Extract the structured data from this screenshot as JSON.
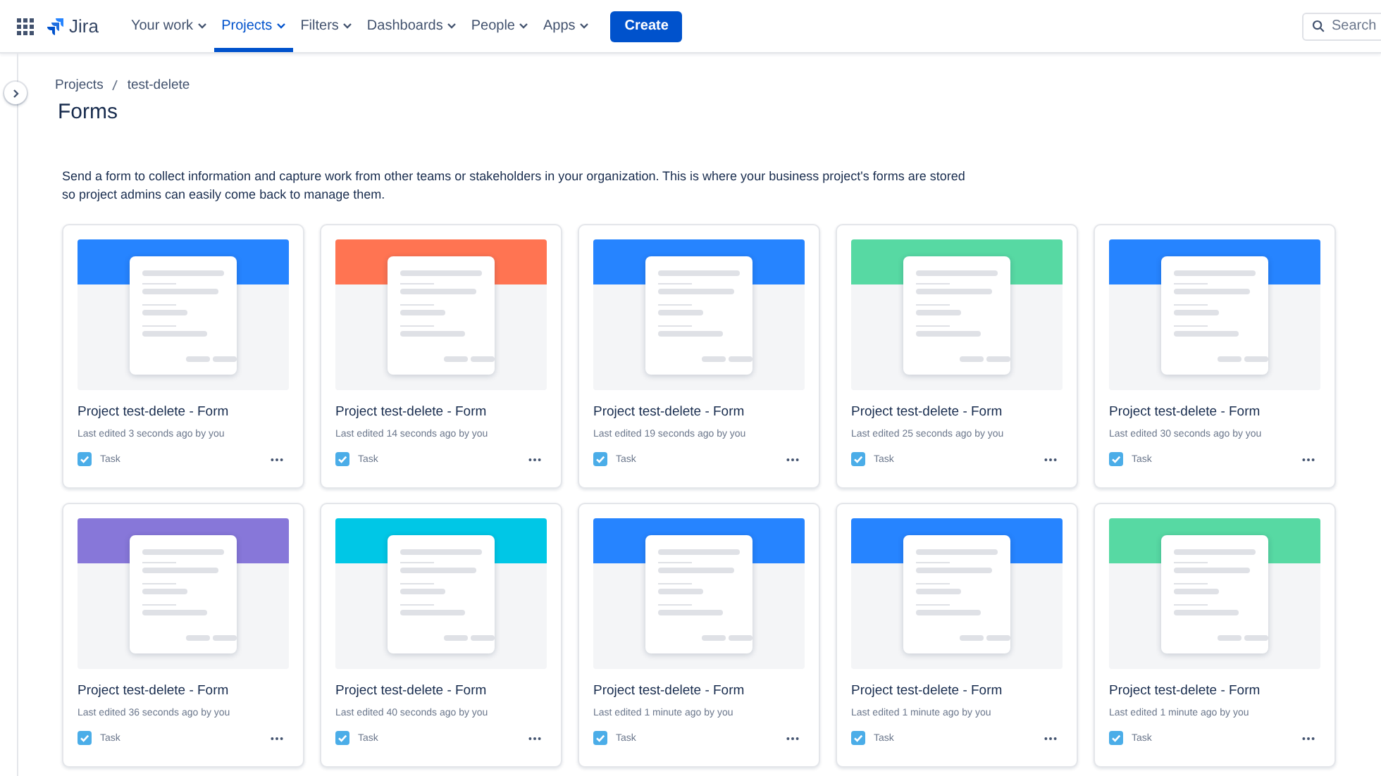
{
  "top_nav": {
    "product": "Jira",
    "menus": [
      {
        "label": "Your work",
        "selected": false
      },
      {
        "label": "Projects",
        "selected": true
      },
      {
        "label": "Filters",
        "selected": false
      },
      {
        "label": "Dashboards",
        "selected": false
      },
      {
        "label": "People",
        "selected": false
      },
      {
        "label": "Apps",
        "selected": false
      }
    ],
    "create_button": "Create",
    "search": {
      "placeholder": "Search"
    }
  },
  "breadcrumbs": [
    "Projects",
    "test-delete"
  ],
  "page_title": "Forms",
  "description": "Send a form to collect information and capture work from other teams or stakeholders in your organization. This is where your business project's forms are stored so project admins can easily come back to manage them.",
  "forms": [
    {
      "title": "Project test-delete - Form",
      "edited": "Last edited 3 seconds ago by you",
      "type": "Task",
      "color": "#2684ff"
    },
    {
      "title": "Project test-delete - Form",
      "edited": "Last edited 14 seconds ago by you",
      "type": "Task",
      "color": "#ff7452"
    },
    {
      "title": "Project test-delete - Form",
      "edited": "Last edited 19 seconds ago by you",
      "type": "Task",
      "color": "#2684ff"
    },
    {
      "title": "Project test-delete - Form",
      "edited": "Last edited 25 seconds ago by you",
      "type": "Task",
      "color": "#57d9a3"
    },
    {
      "title": "Project test-delete - Form",
      "edited": "Last edited 30 seconds ago by you",
      "type": "Task",
      "color": "#2684ff"
    },
    {
      "title": "Project test-delete - Form",
      "edited": "Last edited 36 seconds ago by you",
      "type": "Task",
      "color": "#8777d9"
    },
    {
      "title": "Project test-delete - Form",
      "edited": "Last edited 40 seconds ago by you",
      "type": "Task",
      "color": "#00c7e6"
    },
    {
      "title": "Project test-delete - Form",
      "edited": "Last edited 1 minute ago by you",
      "type": "Task",
      "color": "#2684ff"
    },
    {
      "title": "Project test-delete - Form",
      "edited": "Last edited 1 minute ago by you",
      "type": "Task",
      "color": "#2684ff"
    },
    {
      "title": "Project test-delete - Form",
      "edited": "Last edited 1 minute ago by you",
      "type": "Task",
      "color": "#57d9a3"
    }
  ]
}
